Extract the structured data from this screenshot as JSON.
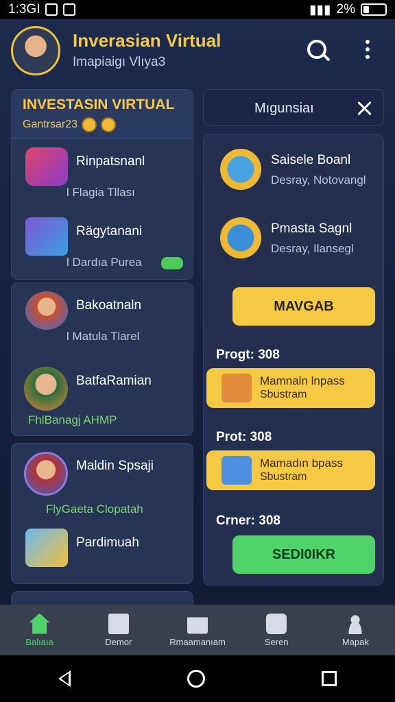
{
  "status": {
    "time": "1:3GI",
    "battery": "2%"
  },
  "header": {
    "title": "Inverasian Virtual",
    "subtitle": "Imapiaigı Vlıya3"
  },
  "left_card": {
    "title": "INVESTASIN VIRTUAL",
    "subtitle": "Gantrsar23",
    "items": [
      {
        "name": "Rinpatsnanl",
        "sub": "l Flagia Tllası"
      },
      {
        "name": "Rägytanani",
        "sub": "l Dardıa Purea"
      }
    ]
  },
  "card2": {
    "items": [
      {
        "name": "Bakoatnaln",
        "sub": "l Matula Tlarel"
      },
      {
        "name": "BatfaRamian",
        "sub": "FhlBanagj AHMP"
      }
    ]
  },
  "card3": {
    "items": [
      {
        "name": "Maldin Spsaji",
        "sub": "FlyGaeta Clopatah"
      },
      {
        "name": "Pardimuah",
        "sub": ""
      }
    ]
  },
  "panel": {
    "title": "Mıgunsiaı",
    "options": [
      {
        "name": "Saisele Boanl",
        "sub": "Desray, Notovangl"
      },
      {
        "name": "Pmasta Sagnl",
        "sub": "Desray, Ilansegl"
      }
    ],
    "primary_button": "MAVGAB",
    "sections": [
      {
        "label": "Progt: 308",
        "line1": "Mamnaln lnpass",
        "line2": "Sbustram"
      },
      {
        "label": "Prot: 308",
        "line1": "Mamadın bpass",
        "line2": "Sbustram"
      }
    ],
    "footer_label": "Crner: 308",
    "secondary_button": "SEDI0IKR"
  },
  "bottom_nav": [
    {
      "label": "Balıaıa",
      "icon": "home-icon"
    },
    {
      "label": "Demor",
      "icon": "news-icon"
    },
    {
      "label": "Rmaamanıam",
      "icon": "mail-icon"
    },
    {
      "label": "Seren",
      "icon": "camera-icon"
    },
    {
      "label": "Mapak",
      "icon": "person-icon"
    }
  ],
  "colors": {
    "accent_yellow": "#f6c945",
    "accent_green": "#4fd36a",
    "bg_navy": "#1c2a4d"
  }
}
